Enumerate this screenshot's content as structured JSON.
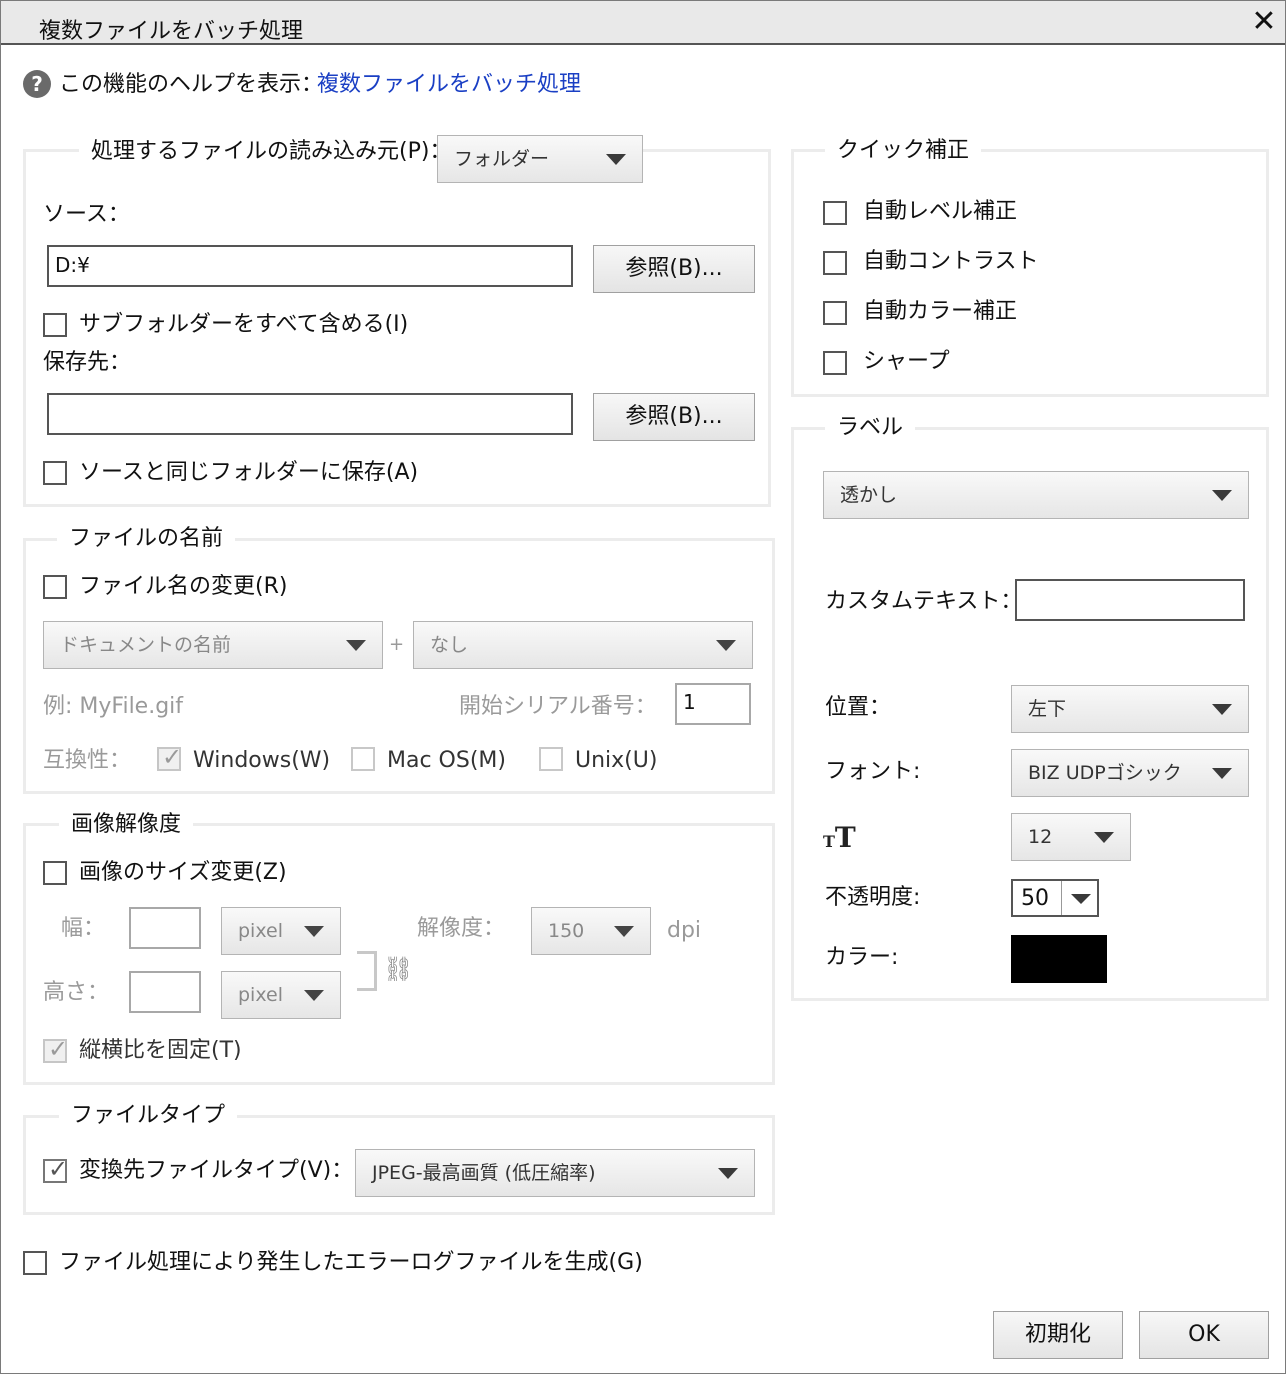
{
  "window": {
    "title": "複数ファイルをバッチ処理",
    "close_glyph": "✕"
  },
  "help": {
    "icon": "question-icon",
    "label": "この機能のヘルプを表示：",
    "link": "複数ファイルをバッチ処理"
  },
  "source_group": {
    "legend": "処理するファイルの読み込み元(P)：",
    "source_type": "フォルダー",
    "source_label": "ソース：",
    "source_value": "D:¥",
    "browse1": "参照(B)...",
    "include_subfolders": "サブフォルダーをすべて含める(I)",
    "dest_label": "保存先：",
    "dest_value": "",
    "browse2": "参照(B)...",
    "same_folder": "ソースと同じフォルダーに保存(A)"
  },
  "filename_group": {
    "legend": "ファイルの名前",
    "rename": "ファイル名の変更(R)",
    "doc_name": "ドキュメントの名前",
    "plus": "+",
    "suffix": "なし",
    "example": "例: MyFile.gif",
    "serial_label": "開始シリアル番号：",
    "serial_value": "1",
    "compat_label": "互換性：",
    "windows": "Windows(W)",
    "macos": "Mac OS(M)",
    "unix": "Unix(U)"
  },
  "resolution_group": {
    "legend": "画像解像度",
    "resize": "画像のサイズ変更(Z)",
    "width_label": "幅：",
    "width_value": "",
    "width_unit": "pixel",
    "height_label": "高さ：",
    "height_value": "",
    "height_unit": "pixel",
    "res_label": "解像度：",
    "res_value": "150",
    "res_unit": "dpi",
    "lock_ratio": "縦横比を固定(T)"
  },
  "filetype_group": {
    "legend": "ファイルタイプ",
    "convert": "変換先ファイルタイプ(V)：",
    "type_value": "JPEG-最高画質 (低圧縮率)"
  },
  "error_log": "ファイル処理により発生したエラーログファイルを生成(G)",
  "quick_group": {
    "legend": "クイック補正",
    "items": [
      "自動レベル補正",
      "自動コントラスト",
      "自動カラー補正",
      "シャープ"
    ]
  },
  "label_group": {
    "legend": "ラベル",
    "label_type": "透かし",
    "custom_text_label": "カスタムテキスト：",
    "custom_text_value": "",
    "position_label": "位置：",
    "position_value": "左下",
    "font_label": "フォント:",
    "font_value": "BIZ UDPゴシック",
    "size_icon": "text-size-icon",
    "size_value": "12",
    "opacity_label": "不透明度:",
    "opacity_value": "50",
    "color_label": "カラー:",
    "color_value": "#000000"
  },
  "buttons": {
    "reset": "初期化",
    "ok": "OK"
  }
}
